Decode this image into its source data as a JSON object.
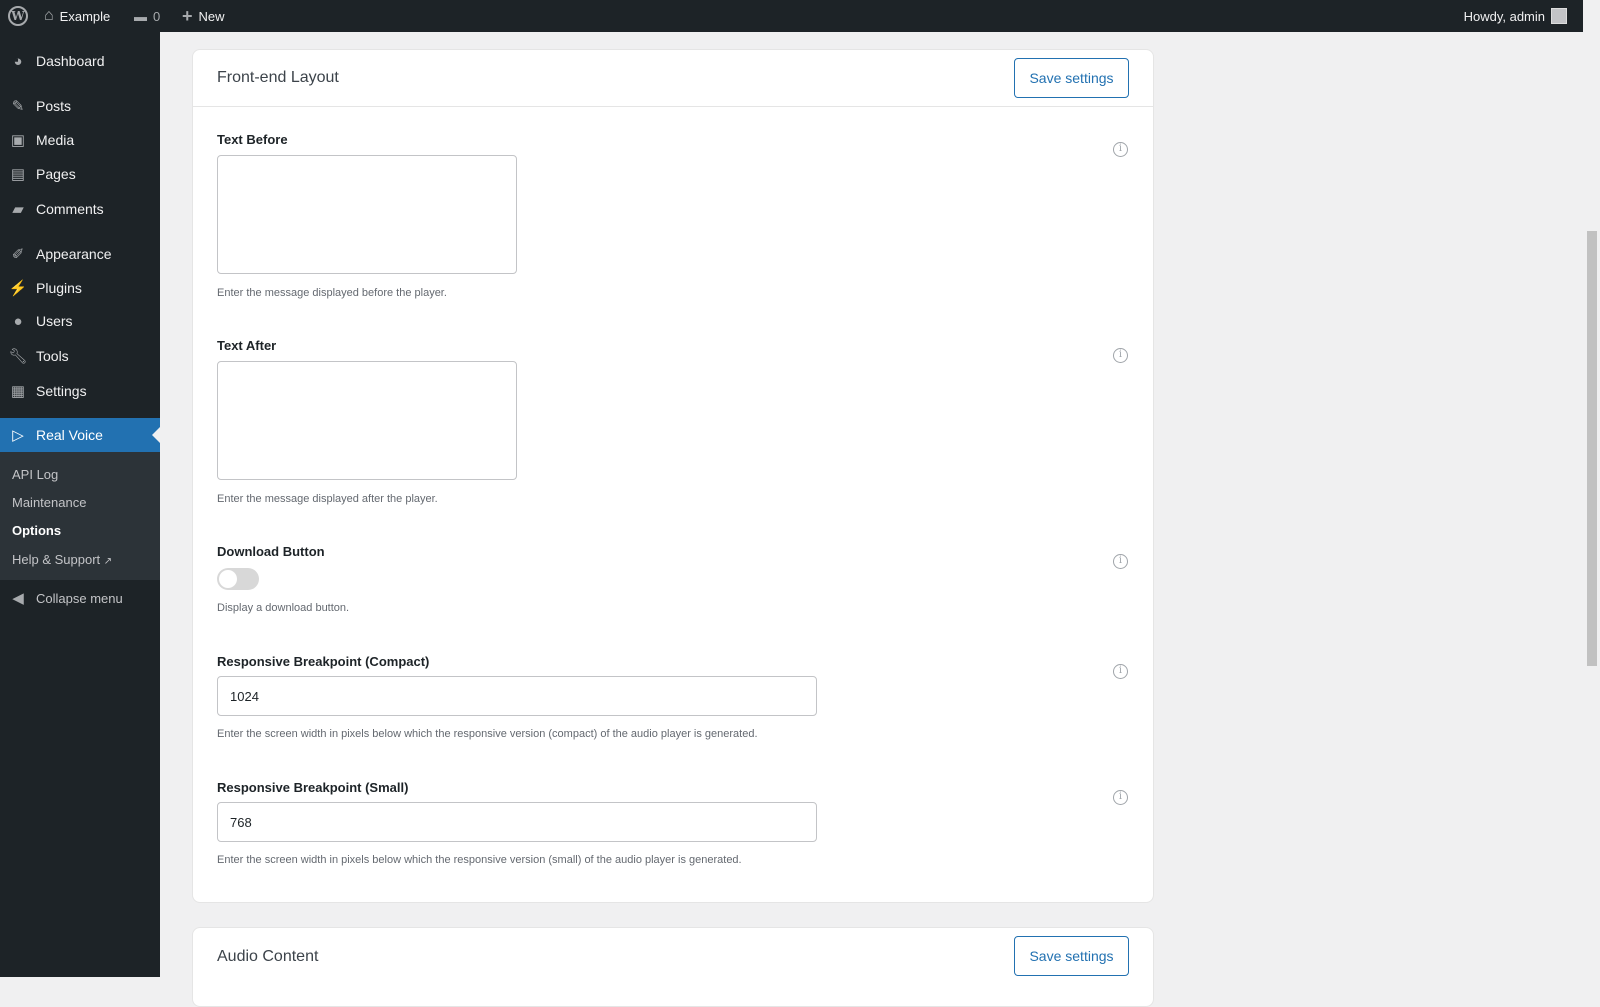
{
  "topbar": {
    "site": "Example",
    "comments": "0",
    "new": "New",
    "howdy": "Howdy, admin"
  },
  "sidebar": {
    "items": [
      "Dashboard",
      "Posts",
      "Media",
      "Pages",
      "Comments",
      "Appearance",
      "Plugins",
      "Users",
      "Tools",
      "Settings"
    ],
    "active": "Real Voice",
    "submenu": [
      "API Log",
      "Maintenance",
      "Options",
      "Help & Support"
    ],
    "collapse": "Collapse menu"
  },
  "card1": {
    "title": "Front-end Layout",
    "save": "Save settings",
    "text_before": {
      "label": "Text Before",
      "help": "Enter the message displayed before the player."
    },
    "text_after": {
      "label": "Text After",
      "help": "Enter the message displayed after the player."
    },
    "download": {
      "label": "Download Button",
      "help": "Display a download button.",
      "enabled": false
    },
    "compact": {
      "label": "Responsive Breakpoint (Compact)",
      "value": "1024",
      "help": "Enter the screen width in pixels below which the responsive version (compact) of the audio player is generated."
    },
    "small": {
      "label": "Responsive Breakpoint (Small)",
      "value": "768",
      "help": "Enter the screen width in pixels below which the responsive version (small) of the audio player is generated."
    }
  },
  "card2": {
    "title": "Audio Content",
    "save": "Save settings"
  },
  "colors": {
    "accent": "#2271b1",
    "sidebar": "#1d2327"
  }
}
